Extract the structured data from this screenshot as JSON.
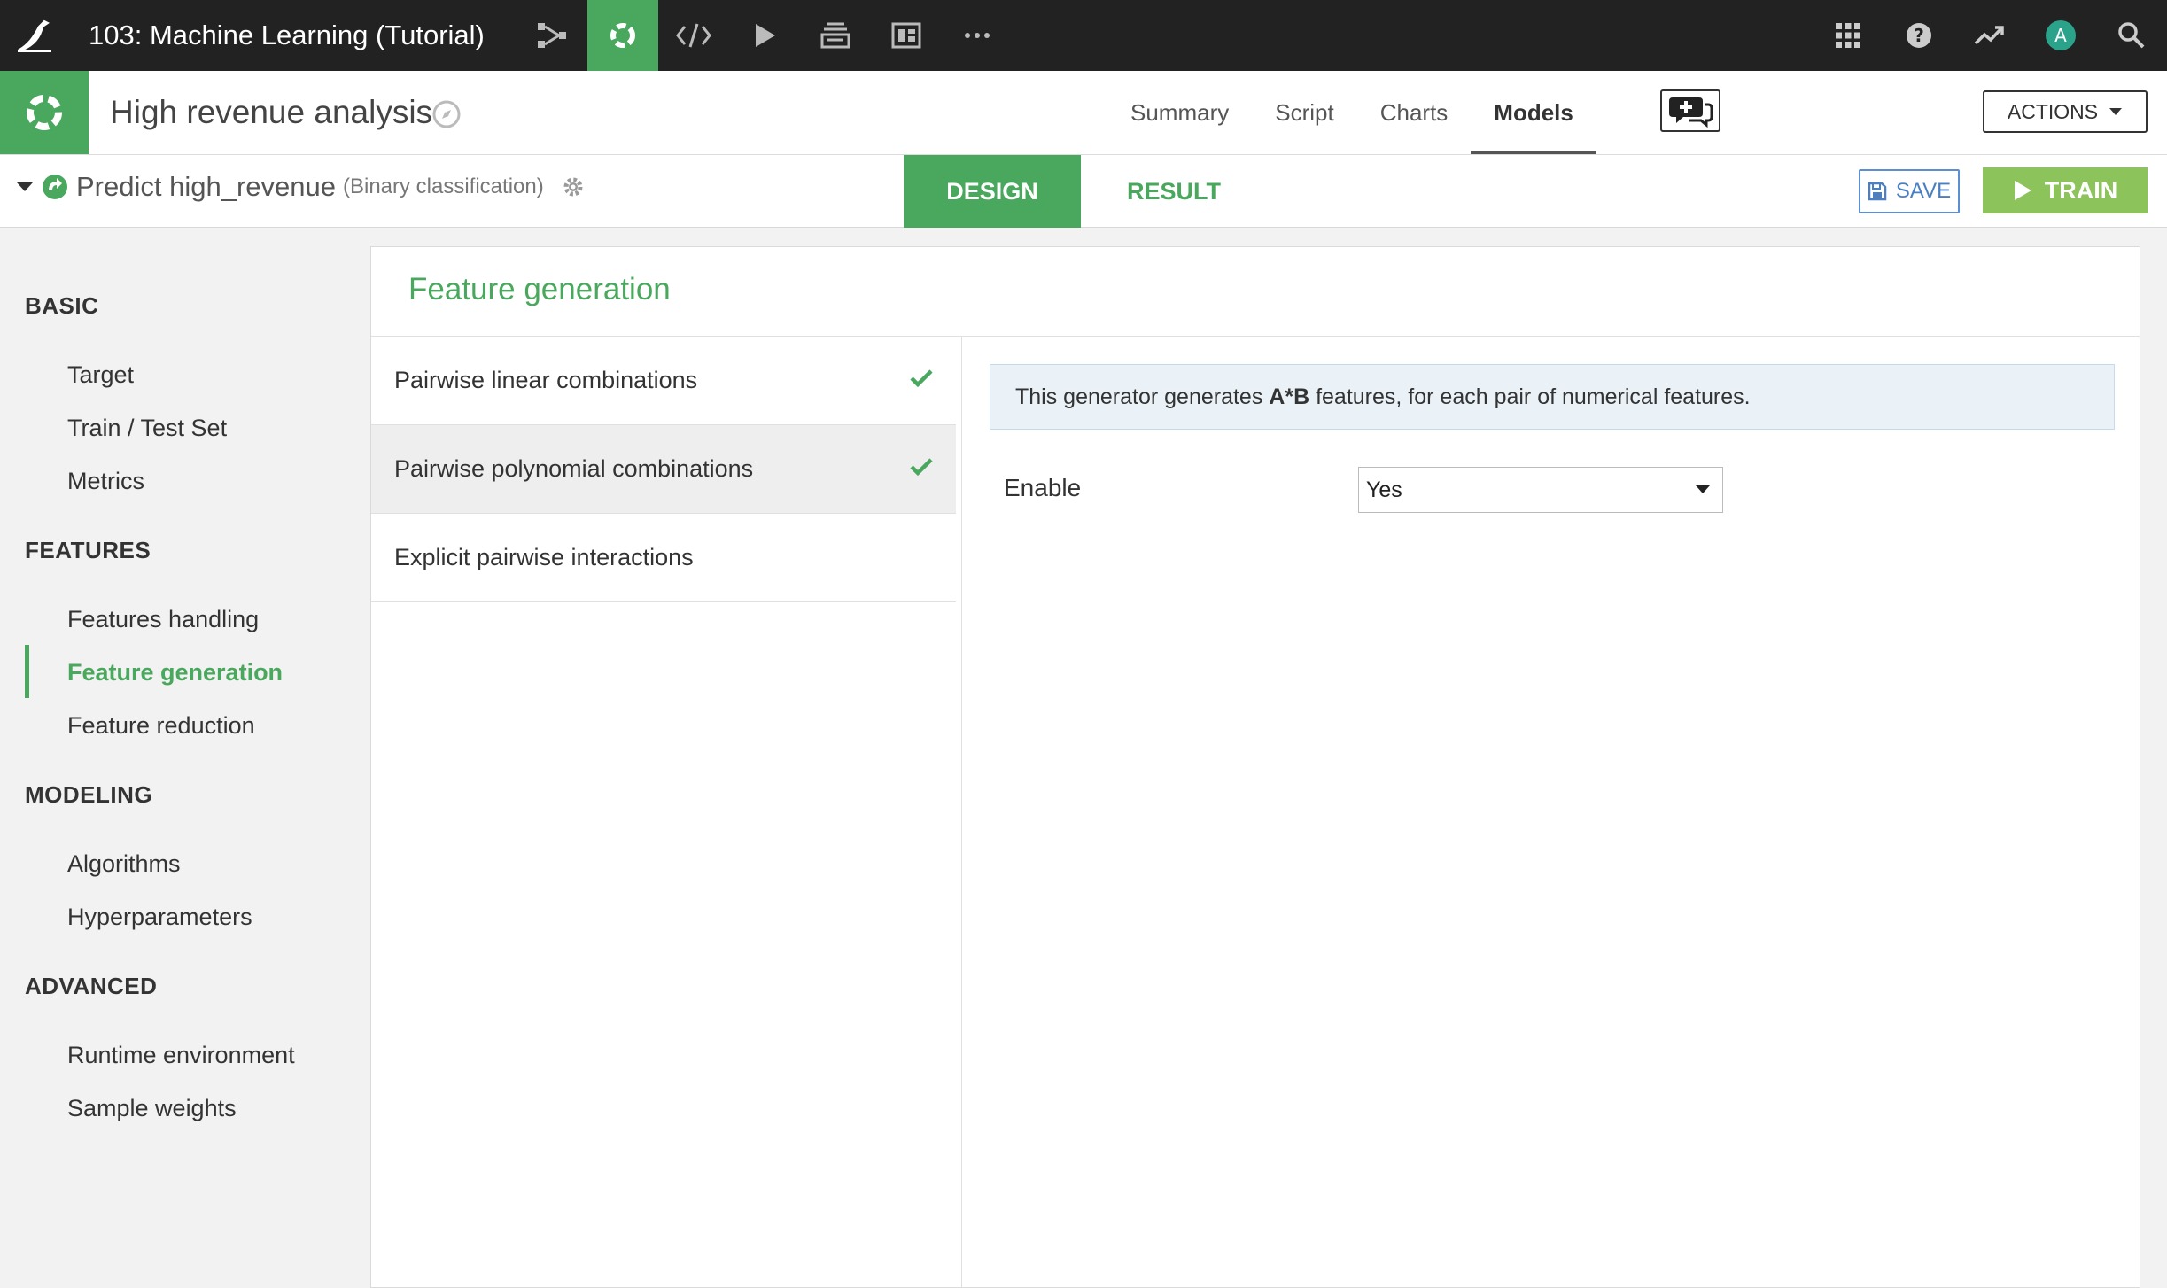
{
  "topbar": {
    "project_title": "103: Machine Learning (Tutorial)",
    "icons": [
      "bird-logo-icon",
      "flow-icon",
      "lab-icon",
      "code-icon",
      "run-icon",
      "jobs-icon",
      "dashboard-icon",
      "more-icon",
      "apps-grid-icon",
      "help-icon",
      "activity-icon",
      "avatar",
      "search-icon"
    ],
    "avatar_letter": "A",
    "accent_color": "#4aa85e"
  },
  "analysis": {
    "title": "High revenue analysis",
    "tabs": [
      {
        "label": "Summary"
      },
      {
        "label": "Script"
      },
      {
        "label": "Charts"
      },
      {
        "label": "Models",
        "active": true
      }
    ],
    "actions_label": "ACTIONS"
  },
  "task": {
    "name": "Predict high_revenue",
    "type": "(Binary classification)",
    "design_label": "DESIGN",
    "result_label": "RESULT",
    "save_label": "SAVE",
    "train_label": "TRAIN"
  },
  "sidebar": {
    "sections": [
      {
        "title": "BASIC",
        "items": [
          "Target",
          "Train / Test Set",
          "Metrics"
        ]
      },
      {
        "title": "FEATURES",
        "items": [
          "Features handling",
          "Feature generation",
          "Feature reduction"
        ]
      },
      {
        "title": "MODELING",
        "items": [
          "Algorithms",
          "Hyperparameters"
        ]
      },
      {
        "title": "ADVANCED",
        "items": [
          "Runtime environment",
          "Sample weights"
        ]
      }
    ],
    "active_item": "Feature generation"
  },
  "panel": {
    "title": "Feature generation",
    "generators": [
      {
        "label": "Pairwise linear combinations",
        "enabled": true
      },
      {
        "label": "Pairwise polynomial combinations",
        "enabled": true,
        "selected": true
      },
      {
        "label": "Explicit pairwise interactions",
        "enabled": false
      }
    ],
    "info_prefix": "This generator generates ",
    "info_bold": "A*B",
    "info_suffix": " features, for each pair of numerical features.",
    "enable_label": "Enable",
    "enable_value": "Yes"
  }
}
